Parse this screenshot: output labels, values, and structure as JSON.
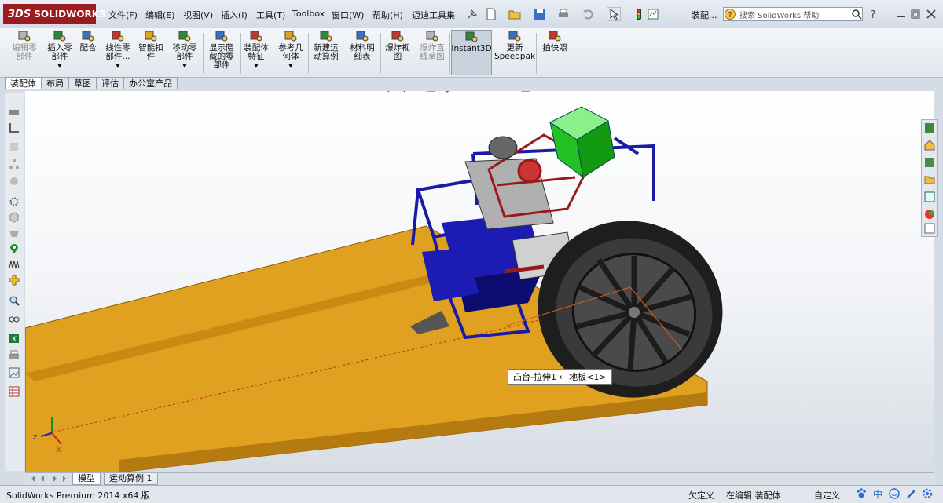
{
  "app": {
    "logo_text": "SOLIDWORKS",
    "logo_ds": "3DS"
  },
  "menu": [
    "文件(F)",
    "编辑(E)",
    "视图(V)",
    "插入(I)",
    "工具(T)",
    "Toolbox",
    "窗口(W)",
    "帮助(H)",
    "迈迪工具集"
  ],
  "titlebar": {
    "doc_label": "装配..."
  },
  "search": {
    "placeholder": "搜索 SolidWorks 帮助"
  },
  "commands": [
    {
      "label": "编辑零\n部件",
      "icon": "edit-component-icon",
      "disabled": true,
      "arrow": false
    },
    {
      "label": "插入零\n部件",
      "icon": "insert-component-icon",
      "disabled": false,
      "arrow": true
    },
    {
      "label": "配合",
      "icon": "mate-icon",
      "disabled": false,
      "arrow": false
    },
    {
      "label": "线性零\n部件...",
      "icon": "linear-pattern-icon",
      "disabled": false,
      "arrow": true
    },
    {
      "label": "智能扣\n件",
      "icon": "smart-fasteners-icon",
      "disabled": false,
      "arrow": false
    },
    {
      "label": "移动零\n部件",
      "icon": "move-component-icon",
      "disabled": false,
      "arrow": true
    },
    {
      "label": "显示隐\n藏的零\n部件",
      "icon": "show-hidden-icon",
      "disabled": false,
      "arrow": false
    },
    {
      "label": "装配体\n特征",
      "icon": "assembly-feature-icon",
      "disabled": false,
      "arrow": true
    },
    {
      "label": "参考几\n何体",
      "icon": "reference-geometry-icon",
      "disabled": false,
      "arrow": true
    },
    {
      "label": "新建运\n动算例",
      "icon": "motion-study-icon",
      "disabled": false,
      "arrow": false
    },
    {
      "label": "材料明\n细表",
      "icon": "bom-icon",
      "disabled": false,
      "arrow": false
    },
    {
      "label": "爆炸视\n图",
      "icon": "exploded-view-icon",
      "disabled": false,
      "arrow": false
    },
    {
      "label": "爆炸直\n线草图",
      "icon": "explode-line-sketch-icon",
      "disabled": true,
      "arrow": false
    },
    {
      "label": "Instant3D",
      "icon": "instant3d-icon",
      "disabled": false,
      "arrow": false,
      "pressed": true
    },
    {
      "label": "更新\nSpeedpak",
      "icon": "speedpak-icon",
      "disabled": false,
      "arrow": false
    },
    {
      "label": "拍快照",
      "icon": "snapshot-icon",
      "disabled": false,
      "arrow": false
    }
  ],
  "tabs": [
    "装配体",
    "布局",
    "草图",
    "评估",
    "办公室产品"
  ],
  "active_tab": 0,
  "tooltip": "凸台-拉伸1 ← 地板<1>",
  "bottom_tabs": [
    "模型",
    "运动算例 1"
  ],
  "status": {
    "app": "SolidWorks Premium 2014 x64 版",
    "definition": "欠定义",
    "mode": "在编辑 装配体",
    "units": "自定义"
  },
  "colors": {
    "board": "#e0a020",
    "frame": "#1a1aa8",
    "hopper": "#22c022",
    "tyre": "#2a2a2a",
    "brand": "#9b1b1f"
  }
}
